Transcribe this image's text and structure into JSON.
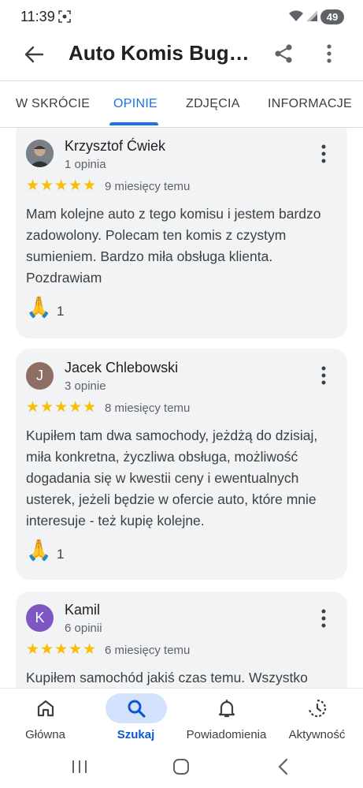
{
  "status": {
    "time": "11:39",
    "battery": "49"
  },
  "app": {
    "title": "Auto Komis Bugat…"
  },
  "tabs": [
    {
      "label": "W SKRÓCIE"
    },
    {
      "label": "OPINIE"
    },
    {
      "label": "ZDJĘCIA"
    },
    {
      "label": "INFORMACJE"
    }
  ],
  "reviews": [
    {
      "author": "Krzysztof Ćwiek",
      "count": "1 opinia",
      "stars": "★★★★★",
      "date": "9 miesięcy temu",
      "text": "Mam kolejne auto z tego komisu i jestem bardzo zadowolony. Polecam ten komis z czystym sumieniem. Bardzo miła obsługa klienta. Pozdrawiam",
      "reaction": "🙏",
      "reaction_count": "1"
    },
    {
      "author": "Jacek Chlebowski",
      "initial": "J",
      "count": "3 opinie",
      "stars": "★★★★★",
      "date": "8 miesięcy temu",
      "text": "Kupiłem tam dwa samochody, jeżdżą do dzisiaj, miła konkretna, życzliwa obsługa, możliwość dogadania się w kwestii ceny i ewentualnych usterek, jeżeli będzie w ofercie auto, które mnie interesuje - też kupię kolejne.",
      "reaction": "🙏",
      "reaction_count": "1"
    },
    {
      "author": "Kamil",
      "initial": "K",
      "count": "6 opinii",
      "stars": "★★★★★",
      "date": "6 miesięcy temu",
      "text": "Kupiłem samochód jakiś czas temu. Wszystko"
    }
  ],
  "bottom_nav": [
    {
      "label": "Główna",
      "icon": "home-icon"
    },
    {
      "label": "Szukaj",
      "icon": "search-icon"
    },
    {
      "label": "Powiadomienia",
      "icon": "bell-icon"
    },
    {
      "label": "Aktywność",
      "icon": "activity-icon"
    }
  ],
  "colors": {
    "accent": "#1a73e8",
    "star": "#fbbc04",
    "card": "#f1f3f4",
    "avatar_j": "#8d6e63",
    "avatar_k": "#7e57c2"
  }
}
